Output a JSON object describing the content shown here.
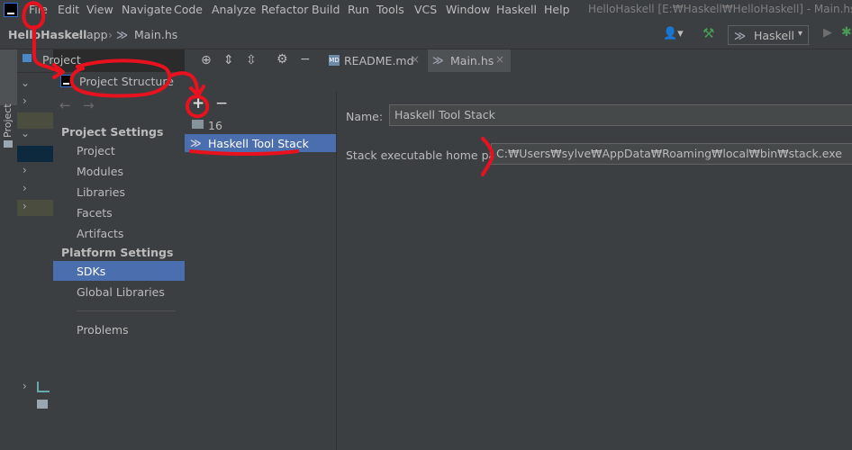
{
  "menubar": {
    "items": [
      "File",
      "Edit",
      "View",
      "Navigate",
      "Code",
      "Analyze",
      "Refactor",
      "Build",
      "Run",
      "Tools",
      "VCS",
      "Window",
      "Haskell",
      "Help"
    ],
    "window_title": "HelloHaskell [E:₩Haskell₩HelloHaskell] - Main.hs"
  },
  "navbar": {
    "crumbs": [
      "HelloHaskell",
      "app",
      "Main.hs"
    ],
    "run_config": "Haskell"
  },
  "stripe": {
    "project_label": "Project"
  },
  "project_panel": {
    "title": "Project"
  },
  "tabs": [
    {
      "label": "README.md",
      "active": false
    },
    {
      "label": "Main.hs",
      "active": true
    }
  ],
  "dialog": {
    "title": "Project Structure",
    "sections": {
      "project_settings": "Project Settings",
      "platform_settings": "Platform Settings"
    },
    "project_items": [
      "Project",
      "Modules",
      "Libraries",
      "Facets",
      "Artifacts"
    ],
    "platform_items": [
      "SDKs",
      "Global Libraries"
    ],
    "selected_item": "SDKs",
    "problems": "Problems",
    "sdk_list": [
      {
        "label": "16",
        "icon": "folder-icon",
        "selected": false
      },
      {
        "label": "Haskell Tool Stack",
        "icon": "haskell-icon",
        "selected": true
      }
    ],
    "name_label": "Name:",
    "name_value": "Haskell Tool Stack",
    "path_label": "Stack executable home path:",
    "path_value": "C:₩Users₩sylve₩AppData₩Roaming₩local₩bin₩stack.exe"
  },
  "colors": {
    "annotation": "#e8121e",
    "selection": "#4b6eaf",
    "panel": "#3c3f41"
  }
}
